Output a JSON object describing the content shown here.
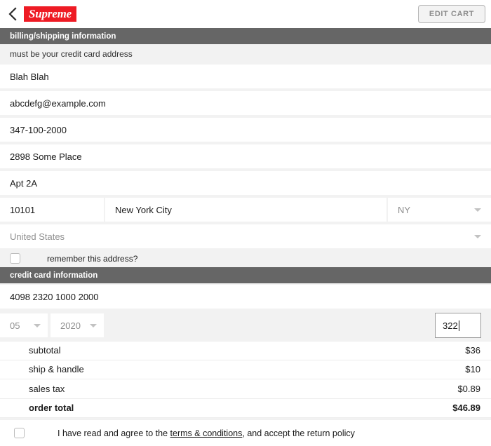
{
  "header": {
    "back_icon": "chevron-left-icon",
    "brand": "Supreme",
    "edit_cart_label": "EDIT CART"
  },
  "billing": {
    "section_title": "billing/shipping information",
    "note": "must be your credit card address",
    "fields": {
      "name": "Blah Blah",
      "email": "abcdefg@example.com",
      "phone": "347-100-2000",
      "address1": "2898 Some Place",
      "address2": "Apt 2A",
      "zip": "10101",
      "city": "New York City",
      "state": "NY",
      "country": "United States"
    },
    "remember_label": "remember this address?"
  },
  "credit_card": {
    "section_title": "credit card information",
    "number": "4098 2320 1000 2000",
    "exp_month": "05",
    "exp_year": "2020",
    "cvv": "322"
  },
  "totals": {
    "rows": [
      {
        "label": "subtotal",
        "value": "$36"
      },
      {
        "label": "ship & handle",
        "value": "$10"
      },
      {
        "label": "sales tax",
        "value": "$0.89"
      },
      {
        "label": "order total",
        "value": "$46.89"
      }
    ]
  },
  "terms": {
    "text_before": "I have read and agree to the ",
    "link": "terms & conditions",
    "text_after": ", and accept the return policy"
  },
  "colors": {
    "brand_red": "#ee1b24",
    "section_gray": "#666666",
    "page_gray": "#f2f2f2"
  }
}
